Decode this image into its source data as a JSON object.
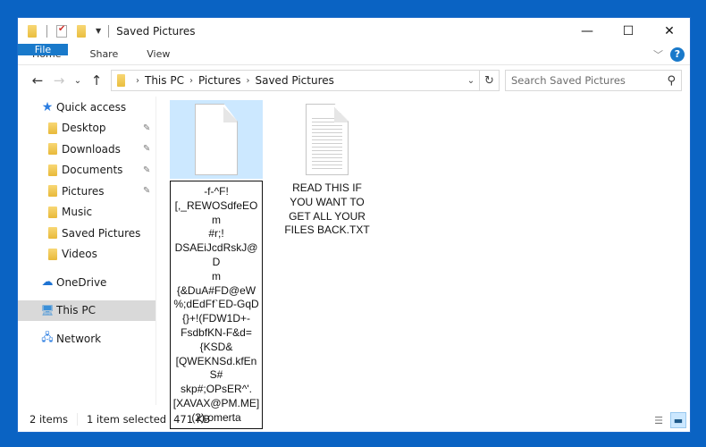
{
  "window": {
    "title": "Saved Pictures",
    "controls": {
      "minimize": "—",
      "maximize": "☐",
      "close": "✕"
    }
  },
  "ribbon": {
    "tabs": [
      {
        "label": "File",
        "active": true
      },
      {
        "label": "Home"
      },
      {
        "label": "Share"
      },
      {
        "label": "View"
      }
    ],
    "help_label": "?",
    "collapse_icon": "chevron-down"
  },
  "navigation": {
    "back": "←",
    "forward": "→",
    "recent": "⌄",
    "up": "↑",
    "breadcrumb": [
      "This PC",
      "Pictures",
      "Saved Pictures"
    ],
    "crumb_separator": "›",
    "refresh": "↻",
    "dropdown": "⌄",
    "search_placeholder": "Search Saved Pictures",
    "search_value": ""
  },
  "sidebar": {
    "quick_access": {
      "label": "Quick access",
      "icon": "star"
    },
    "items": [
      {
        "label": "Desktop",
        "icon": "desktop-folder",
        "pinned": true
      },
      {
        "label": "Downloads",
        "icon": "downloads-folder",
        "pinned": true
      },
      {
        "label": "Documents",
        "icon": "documents-folder",
        "pinned": true
      },
      {
        "label": "Pictures",
        "icon": "pictures-folder",
        "pinned": true
      },
      {
        "label": "Music",
        "icon": "music-folder",
        "pinned": false
      },
      {
        "label": "Saved Pictures",
        "icon": "folder",
        "pinned": false
      },
      {
        "label": "Videos",
        "icon": "videos-folder",
        "pinned": false
      }
    ],
    "onedrive": {
      "label": "OneDrive",
      "icon": "cloud"
    },
    "thispc": {
      "label": "This PC",
      "icon": "computer",
      "selected": true
    },
    "network": {
      "label": "Network",
      "icon": "network"
    },
    "pin_glyph": "📌"
  },
  "files": [
    {
      "name": "-f-^F![,_REWOSdfeEOm#r;!DSAEiJcdRskJ@Dm{&DuA#FD@eW%;dEdFf`ED-GqD{}+!(FDW1D+-FsdbfKN-F&d={KSD&[QWEKNSd.kfEnS#skp#;OPsER^'.[XAVAX@PM.ME](2).omerta",
      "name_lines": [
        "-f-^F!",
        "[,_REWOSdfeEOm",
        "#r;!",
        "DSAEiJcdRskJ@D",
        "m",
        "{&DuA#FD@eW",
        "%;dEdFf`ED-GqD",
        "{}+!(FDW1D+-",
        "FsdbfKN-F&d=",
        "{KSD&",
        "[QWEKNSd.kfEnS#",
        "skp#;OPsER^'.",
        "[XAVAX@PM.ME]",
        "(2).omerta"
      ],
      "type": "blank-document",
      "selected": true,
      "renaming": true
    },
    {
      "name": "READ THIS IF YOU WANT TO GET ALL YOUR FILES BACK.TXT",
      "name_lines": [
        "READ THIS IF",
        "YOU WANT TO",
        "GET ALL YOUR",
        "FILES BACK.TXT"
      ],
      "type": "text-document",
      "selected": false
    }
  ],
  "status": {
    "item_count": "2 items",
    "selection": "1 item selected",
    "size": "471 KB"
  },
  "view_modes": [
    {
      "name": "details",
      "active": false
    },
    {
      "name": "large-icons",
      "active": true
    }
  ]
}
